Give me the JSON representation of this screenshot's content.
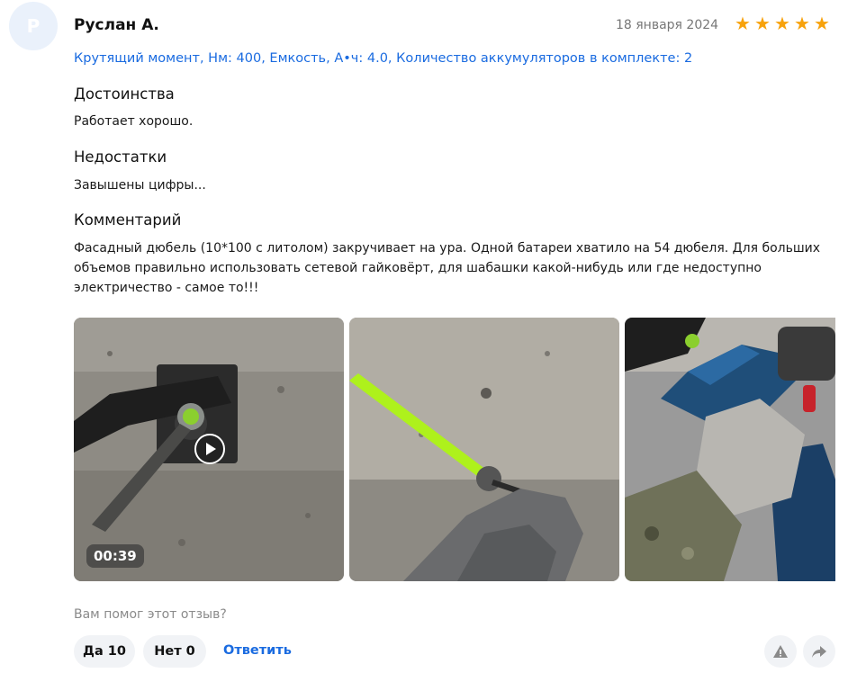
{
  "review": {
    "avatar_letter": "Р",
    "author": "Руслан А.",
    "date": "18 января 2024",
    "rating": 5,
    "specs": "Крутящий момент, Нм: 400, Емкость, А•ч: 4.0, Количество аккумуляторов в комплекте: 2",
    "pros_title": "Достоинства",
    "pros_text": "Работает хорошо.",
    "cons_title": "Недостатки",
    "cons_text": "Завышены цифры...",
    "comment_title": "Комментарий",
    "comment_text": "Фасадный дюбель (10*100 с литолом) закручивает на ура. Одной батареи хватило на 54 дюбеля. Для больших объемов правильно использовать сетевой гайковёрт, для шабашки какой-нибудь или где недоступно электричество - самое то!!!"
  },
  "media": {
    "video_duration": "00:39",
    "photos": [
      "video-thumbnail",
      "anchor-photo",
      "drill-photo"
    ]
  },
  "feedback": {
    "question": "Вам помог этот отзыв?",
    "yes_label": "Да 10",
    "no_label": "Нет 0",
    "reply_label": "Ответить"
  },
  "icons": {
    "star": "star-icon",
    "play": "play-icon",
    "report": "warning-triangle-icon",
    "share": "share-arrow-icon"
  },
  "colors": {
    "accent": "#1a6be0",
    "star": "#f7a20c",
    "button_bg": "#f1f3f6",
    "muted_text": "#8a8a8a"
  }
}
